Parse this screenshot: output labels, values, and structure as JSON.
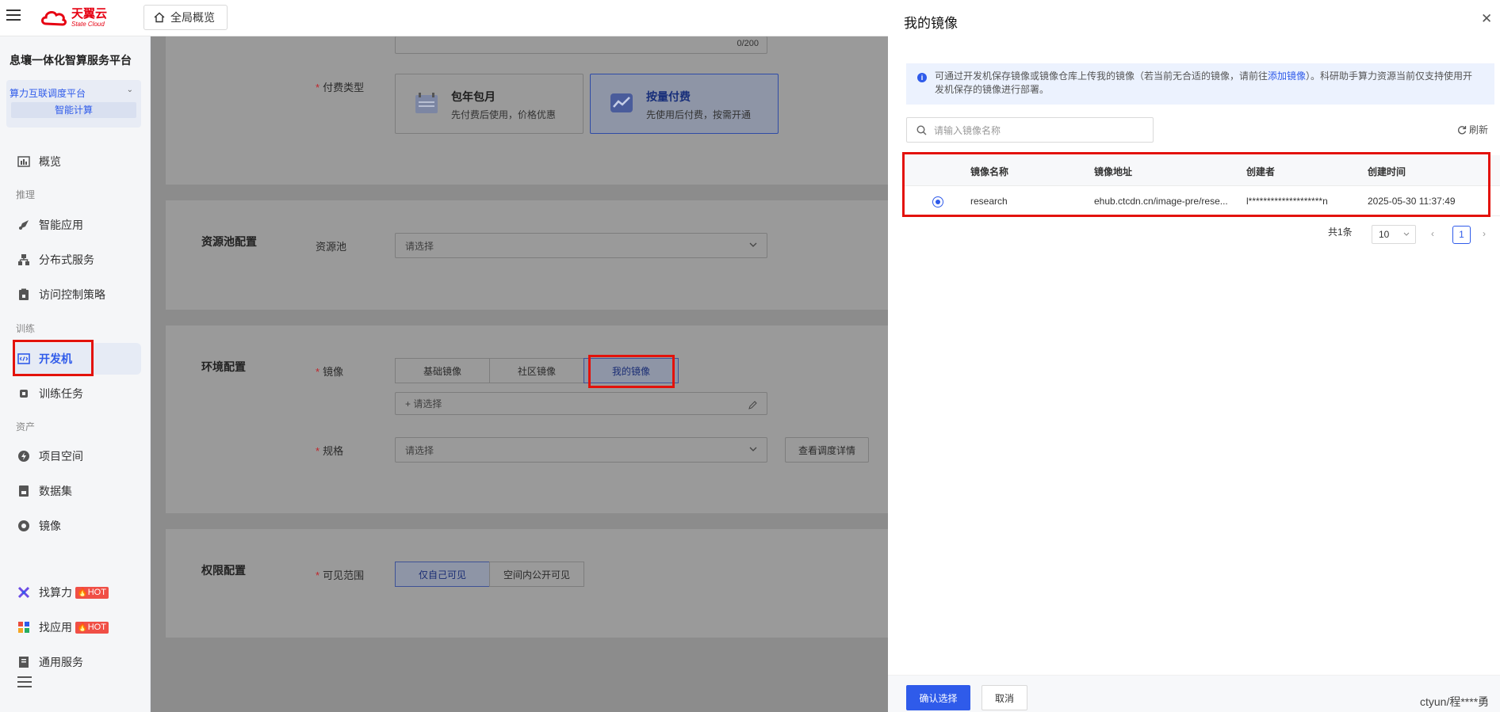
{
  "header": {
    "logo_cn": "天翼云",
    "logo_en": "State Cloud",
    "overview_label": "全局概览"
  },
  "sidebar": {
    "platform_title": "息壤一体化智算服务平台",
    "scheduler_label": "算力互联调度平台",
    "scheduler_sub": "智能计算",
    "items": {
      "overview": "概览",
      "section_inference": "推理",
      "smart_app": "智能应用",
      "distributed": "分布式服务",
      "access_policy": "访问控制策略",
      "section_training": "训练",
      "dev_machine": "开发机",
      "training_task": "训练任务",
      "section_assets": "资产",
      "project_space": "项目空间",
      "dataset": "数据集",
      "image": "镜像",
      "find_compute": "找算力",
      "find_app": "找应用",
      "hot_badge": "HOT",
      "general_service": "通用服务"
    }
  },
  "main": {
    "char_count": "0/200",
    "pay_type_label": "付费类型",
    "pay_options": [
      {
        "title": "包年包月",
        "desc": "先付费后使用，价格优惠"
      },
      {
        "title": "按量付费",
        "desc": "先使用后付费，按需开通"
      }
    ],
    "resource_section": "资源池配置",
    "resource_pool_label": "资源池",
    "resource_pool_placeholder": "请选择",
    "env_section": "环境配置",
    "image_label": "镜像",
    "image_tabs": [
      "基础镜像",
      "社区镜像",
      "我的镜像"
    ],
    "image_select_placeholder": "+ 请选择",
    "spec_label": "规格",
    "spec_placeholder": "请选择",
    "spec_detail_button": "查看调度详情",
    "perm_section": "权限配置",
    "visibility_label": "可见范围",
    "visibility_options": [
      "仅自己可见",
      "空间内公开可见"
    ]
  },
  "drawer": {
    "title": "我的镜像",
    "notice_before": "可通过开发机保存镜像或镜像仓库上传我的镜像（若当前无合适的镜像，请前往",
    "notice_link": "添加镜像",
    "notice_after": "）。科研助手算力资源当前仅支持使用开发机保存的镜像进行部署。",
    "search_placeholder": "请输入镜像名称",
    "refresh_label": "刷新",
    "columns": [
      "镜像名称",
      "镜像地址",
      "创建者",
      "创建时间"
    ],
    "rows": [
      {
        "name": "research",
        "address": "ehub.ctcdn.cn/image-pre/rese...",
        "creator": "l********************n",
        "created": "2025-05-30 11:37:49"
      }
    ],
    "pagination": {
      "total_label": "共1条",
      "page_size": "10",
      "current_page": "1"
    },
    "confirm_button": "确认选择",
    "cancel_button": "取消"
  },
  "watermark": "ctyun/程****勇",
  "colors": {
    "accent": "#2f5bea",
    "highlight_box": "#e3120b",
    "logo_red": "#e60012"
  }
}
